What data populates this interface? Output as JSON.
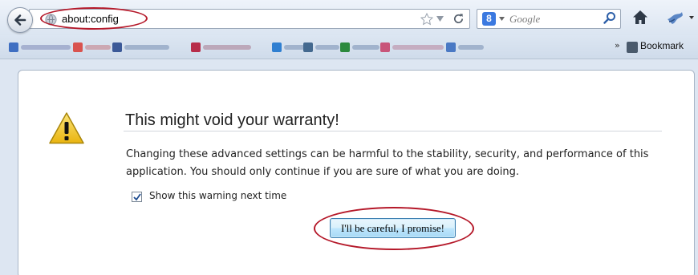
{
  "toolbar": {
    "url": "about:config",
    "search_placeholder": "Google",
    "search_engine_glyph": "8",
    "icons": [
      "back-arrow-icon",
      "site-identity-icon",
      "star-icon",
      "dropmarker-icon",
      "reload-icon",
      "google-search-icon",
      "magnifier-icon",
      "home-icon",
      "addon-icon",
      "overflow-icon"
    ]
  },
  "bookmarks": {
    "chevron": "»",
    "label": "Bookmark"
  },
  "warning": {
    "title": "This might void your warranty!",
    "body": "Changing these advanced settings can be harmful to the stability, security, and performance of this application. You should only continue if you are sure of what you are doing.",
    "checkbox_label": "Show this warning next time",
    "checkbox_checked": true,
    "button_label": "I'll be careful, I promise!"
  },
  "colors": {
    "annotation_red": "#b5192a",
    "warning_yellow": "#f3c61c",
    "button_blue": "#3c7fb1"
  }
}
